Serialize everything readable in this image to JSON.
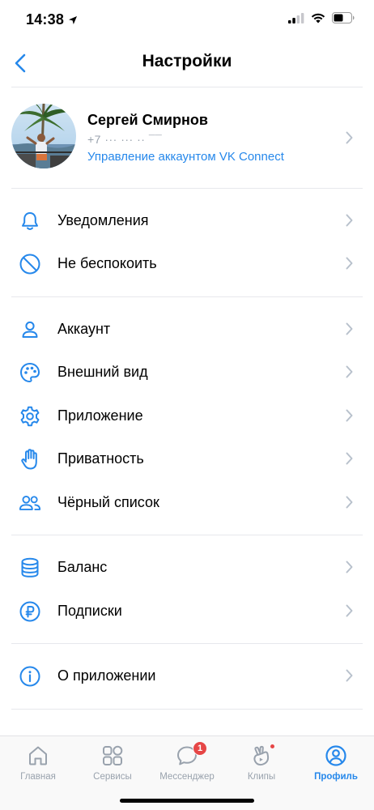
{
  "status_bar": {
    "time": "14:38"
  },
  "nav": {
    "title": "Настройки"
  },
  "profile": {
    "name": "Сергей Смирнов",
    "phone": "+7 ··· ··· ·· ¯¯",
    "link": "Управление аккаунтом VK Connect"
  },
  "menu": {
    "notifications": "Уведомления",
    "dnd": "Не беспокоить",
    "account": "Аккаунт",
    "appearance": "Внешний вид",
    "app": "Приложение",
    "privacy": "Приватность",
    "blacklist": "Чёрный список",
    "balance": "Баланс",
    "subscriptions": "Подписки",
    "about": "О приложении"
  },
  "tabs": {
    "home": "Главная",
    "services": "Сервисы",
    "messenger": "Мессенджер",
    "messenger_badge": "1",
    "clips": "Клипы",
    "profile": "Профиль"
  },
  "colors": {
    "accent": "#2688eb",
    "badge": "#e64646",
    "secondary": "#99a2ad"
  }
}
